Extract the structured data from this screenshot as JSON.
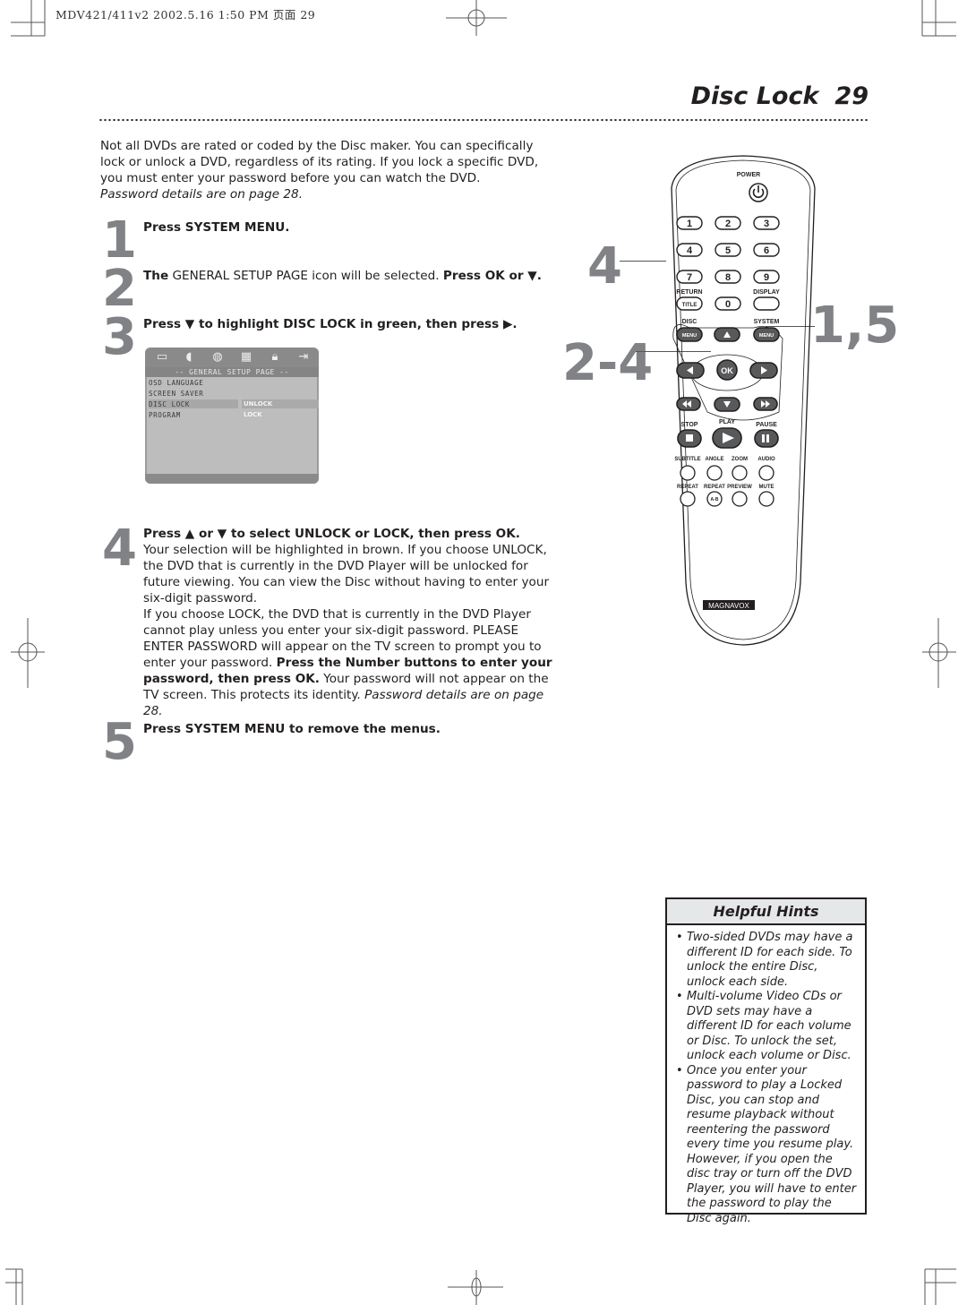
{
  "print_slug": "MDV421/411v2  2002.5.16  1:50 PM  页面 29",
  "header": {
    "title": "Disc Lock",
    "page_number": "29"
  },
  "intro": {
    "text": "Not all DVDs are rated or coded by the Disc maker. You can specifically lock or unlock a DVD, regardless of its rating. If you lock a specific DVD, you must enter your password before you can watch the DVD. ",
    "italic": "Password details are on page 28."
  },
  "steps": [
    {
      "number": "1",
      "bold": "Press SYSTEM MENU.",
      "text": ""
    },
    {
      "number": "2",
      "bold_prefix": "The",
      "text": " GENERAL SETUP PAGE icon will be selected. ",
      "bold": "Press OK or ▼."
    },
    {
      "number": "3",
      "bold": "Press ▼  to highlight DISC LOCK in green, then press ▶."
    },
    {
      "number": "4",
      "bold": "Press ▲ or ▼ to select UNLOCK or LOCK, then press OK.",
      "text1": "Your selection will be highlighted in brown. If you choose UNLOCK, the DVD that is currently in the DVD Player will be unlocked for future viewing. You can view the Disc without having to enter your six-digit password.",
      "text2": "If you choose LOCK, the DVD that is currently in the DVD Player cannot play unless you enter your six-digit password. PLEASE ENTER PASSWORD will appear on the TV screen to prompt you to enter your password. ",
      "bold2": "Press the Number buttons to enter your password, then press OK.",
      "text3": "  Your password will not appear on the TV screen. This protects its identity. ",
      "italic": "Password details are on page 28."
    },
    {
      "number": "5",
      "bold": "Press SYSTEM MENU to remove the menus."
    }
  ],
  "menu_screen": {
    "icons": [
      "general-setup-icon",
      "audio-setup-icon",
      "video-setup-icon",
      "preference-icon",
      "password-lock-icon",
      "exit-icon"
    ],
    "header": "-- GENERAL SETUP PAGE --",
    "rows": [
      "OSD LANGUAGE",
      "SCREEN SAVER",
      "DISC LOCK",
      "PROGRAM"
    ],
    "selected_row": "DISC LOCK",
    "options": [
      "UNLOCK",
      "LOCK"
    ],
    "selected_option": "UNLOCK"
  },
  "callouts": {
    "left_top": "4",
    "left_mid": "2-4",
    "right": "1,5"
  },
  "remote": {
    "brand": "MAGNAVOX",
    "power_label": "POWER",
    "digits": [
      "1",
      "2",
      "3",
      "4",
      "5",
      "6",
      "7",
      "8",
      "9",
      "0"
    ],
    "return_label": "RETURN",
    "title_label": "TITLE",
    "display_label": "DISPLAY",
    "disc_label": "DISC",
    "system_label": "SYSTEM",
    "menu_label": "MENU",
    "ok_label": "OK",
    "stop_label": "STOP",
    "play_label": "PLAY",
    "pause_label": "PAUSE",
    "row1_labels": [
      "SUBTITLE",
      "ANGLE",
      "ZOOM",
      "AUDIO"
    ],
    "row2_labels": [
      "REPEAT",
      "REPEAT",
      "PREVIEW",
      "MUTE"
    ],
    "ab_label": "A-B"
  },
  "hints": {
    "title": "Helpful Hints",
    "items": [
      "Two-sided DVDs may have a different ID for each side. To unlock the entire Disc, unlock each side.",
      "Multi-volume Video CDs or DVD sets may have a different ID for each volume or Disc. To unlock the set, unlock each volume or Disc.",
      "Once you enter your password to play a Locked Disc, you can stop and resume playback without reentering the password every time you resume play. However, if you open the disc tray or turn off the DVD Player, you will have to enter the password to play the Disc again."
    ]
  }
}
